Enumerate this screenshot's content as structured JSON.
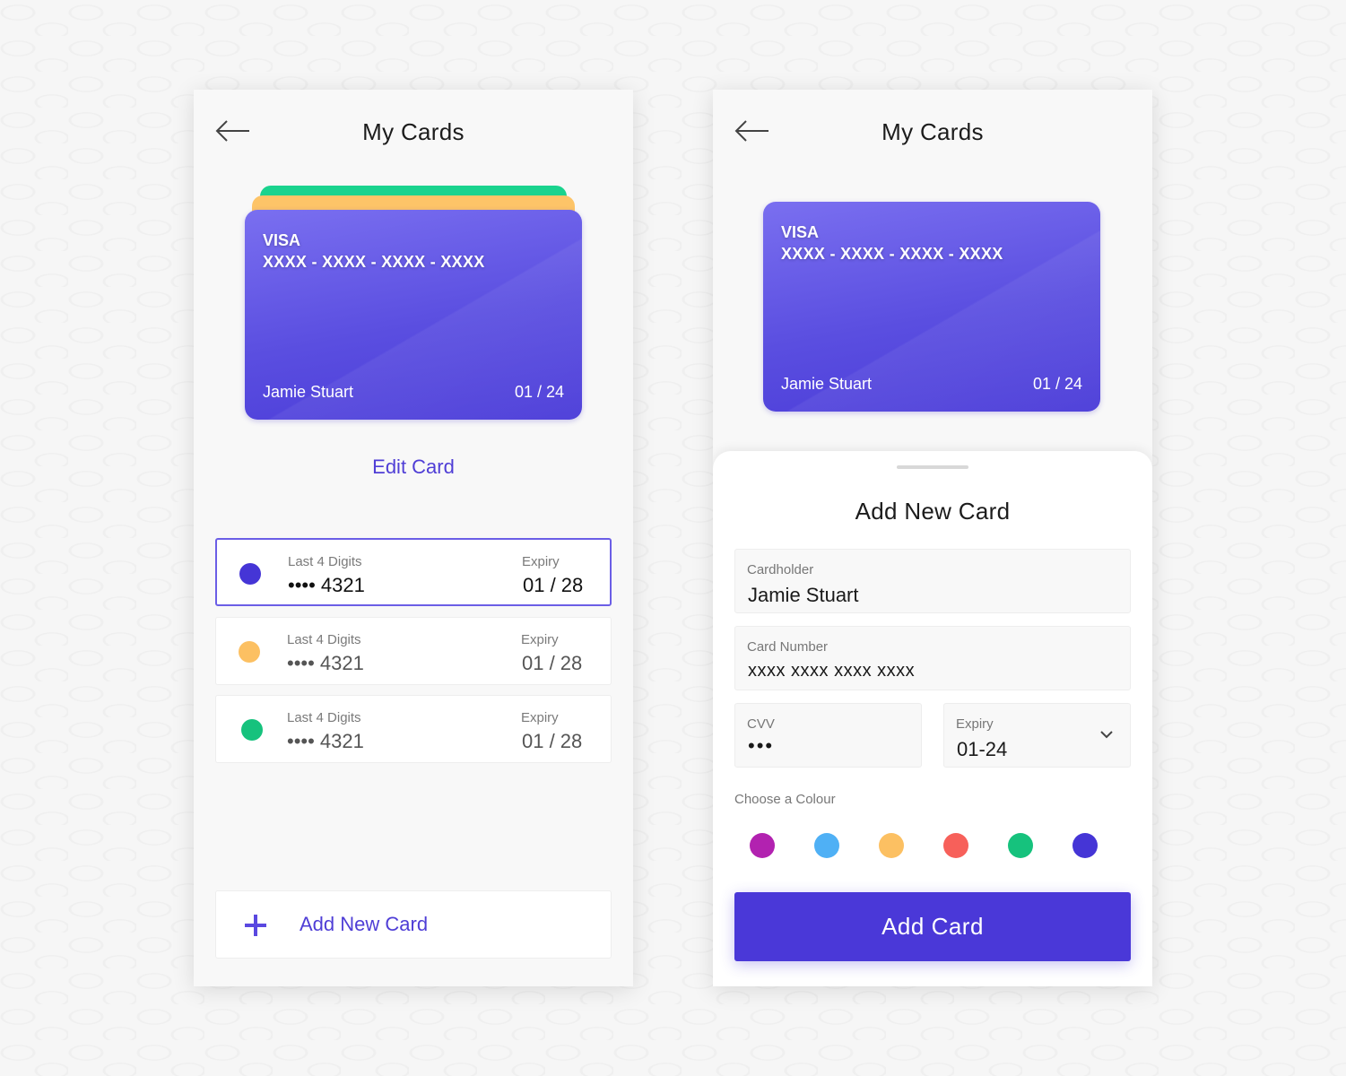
{
  "left_screen": {
    "header": {
      "title": "My Cards",
      "back_icon": "arrow-left-icon"
    },
    "card": {
      "brand": "VISA",
      "number": "XXXX - XXXX - XXXX - XXXX",
      "holder": "Jamie Stuart",
      "expiry": "01 / 24",
      "color": "#5a4ee0"
    },
    "stacked_card_colors": [
      "#1ad38e",
      "#fdc468"
    ],
    "edit_label": "Edit Card",
    "card_list": [
      {
        "color": "#4535d6",
        "digits_label": "Last 4 Digits",
        "digits": "•••• 4321",
        "expiry_label": "Expiry",
        "expiry": "01 / 28",
        "selected": true
      },
      {
        "color": "#fcc062",
        "digits_label": "Last 4 Digits",
        "digits": "•••• 4321",
        "expiry_label": "Expiry",
        "expiry": "01 / 28",
        "selected": false
      },
      {
        "color": "#16c27d",
        "digits_label": "Last 4 Digits",
        "digits": "•••• 4321",
        "expiry_label": "Expiry",
        "expiry": "01 / 28",
        "selected": false
      }
    ],
    "add_new_label": "Add New Card",
    "add_new_icon": "plus-icon"
  },
  "right_screen": {
    "header": {
      "title": "My Cards",
      "back_icon": "arrow-left-icon"
    },
    "card": {
      "brand": "VISA",
      "number": "XXXX - XXXX - XXXX - XXXX",
      "holder": "Jamie Stuart",
      "expiry": "01 / 24"
    },
    "sheet": {
      "title": "Add New Card",
      "fields": {
        "cardholder": {
          "label": "Cardholder",
          "value": "Jamie Stuart"
        },
        "card_number": {
          "label": "Card Number",
          "value": "xxxx xxxx xxxx xxxx"
        },
        "cvv": {
          "label": "CVV",
          "value": "•••"
        },
        "expiry": {
          "label": "Expiry",
          "value": "01-24",
          "icon": "chevron-down-icon"
        }
      },
      "colour_label": "Choose a Colour",
      "colours": [
        {
          "name": "purple",
          "hex": "#b222b0"
        },
        {
          "name": "blue",
          "hex": "#4fb0f5"
        },
        {
          "name": "yellow",
          "hex": "#fcc062"
        },
        {
          "name": "red",
          "hex": "#f7605a"
        },
        {
          "name": "green",
          "hex": "#16c27d"
        },
        {
          "name": "indigo",
          "hex": "#4535d6",
          "selected": true
        }
      ],
      "submit_label": "Add Card"
    }
  },
  "accent_color": "#4a38d8"
}
